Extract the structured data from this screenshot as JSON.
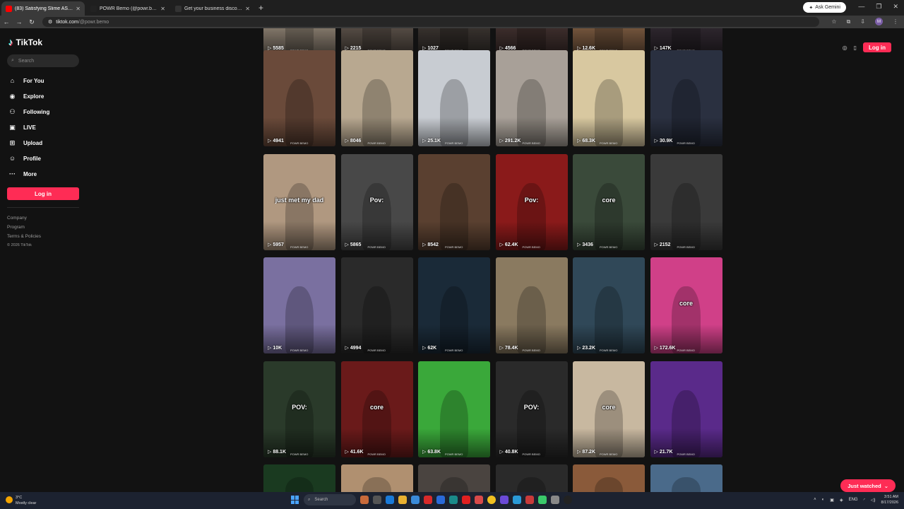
{
  "browser": {
    "tabs": [
      {
        "title": "(83) Satisfying Slime ASMR Vid",
        "favicon_color": "#ff0000",
        "active": true
      },
      {
        "title": "POWR Bemo (@powr.bemo) | T",
        "favicon_color": "#222222",
        "active": false
      },
      {
        "title": "Get your business discovered o",
        "favicon_color": "#333333",
        "active": false
      }
    ],
    "new_tab": "+",
    "gemini_label": "Ask Gemini",
    "url_host": "tiktok.com",
    "url_path": "/@powr.bemo",
    "profile_letter": "M"
  },
  "sidebar": {
    "logo_text": "TikTok",
    "search_placeholder": "Search",
    "items": [
      {
        "label": "For You",
        "icon": "home-icon"
      },
      {
        "label": "Explore",
        "icon": "compass-icon"
      },
      {
        "label": "Following",
        "icon": "following-icon"
      },
      {
        "label": "LIVE",
        "icon": "live-icon"
      },
      {
        "label": "Upload",
        "icon": "upload-icon"
      },
      {
        "label": "Profile",
        "icon": "profile-icon"
      },
      {
        "label": "More",
        "icon": "more-icon"
      }
    ],
    "login_label": "Log in",
    "footer": [
      "Company",
      "Program",
      "Terms & Policies",
      "© 2026 TikTok"
    ]
  },
  "header": {
    "login_label": "Log in"
  },
  "videos": [
    {
      "views": "5585",
      "caption": "",
      "bg": "#8a7e70"
    },
    {
      "views": "2215",
      "caption": "",
      "bg": "#5a5048"
    },
    {
      "views": "1027",
      "caption": "",
      "bg": "#3a3430"
    },
    {
      "views": "4566",
      "caption": "",
      "bg": "#40302e"
    },
    {
      "views": "12.6K",
      "caption": "",
      "bg": "#7a5a40"
    },
    {
      "views": "147K",
      "caption": "",
      "bg": "#302830"
    },
    {
      "views": "4941",
      "caption": "",
      "bg": "#6a4a3a"
    },
    {
      "views": "8046",
      "caption": "",
      "bg": "#b8a890"
    },
    {
      "views": "25.1K",
      "caption": "",
      "bg": "#c8ccd2"
    },
    {
      "views": "291.2K",
      "caption": "",
      "bg": "#a8a098"
    },
    {
      "views": "68.3K",
      "caption": "",
      "bg": "#d8c8a0"
    },
    {
      "views": "30.9K",
      "caption": "",
      "bg": "#2a3040"
    },
    {
      "views": "5957",
      "caption": "just met my dad",
      "bg": "#b09880"
    },
    {
      "views": "5865",
      "caption": "Pov:",
      "bg": "#484848"
    },
    {
      "views": "8542",
      "caption": "",
      "bg": "#5a4030"
    },
    {
      "views": "62.4K",
      "caption": "Pov:",
      "bg": "#8a1a1a"
    },
    {
      "views": "3436",
      "caption": "core",
      "bg": "#3a4a3a"
    },
    {
      "views": "2152",
      "caption": "",
      "bg": "#3a3a3a"
    },
    {
      "views": "10K",
      "caption": "",
      "bg": "#7a70a0"
    },
    {
      "views": "4994",
      "caption": "",
      "bg": "#2a2a2a"
    },
    {
      "views": "62K",
      "caption": "",
      "bg": "#1a2a38"
    },
    {
      "views": "78.4K",
      "caption": "",
      "bg": "#8a7a60"
    },
    {
      "views": "23.2K",
      "caption": "",
      "bg": "#304858"
    },
    {
      "views": "172.6K",
      "caption": "core",
      "bg": "#d04088"
    },
    {
      "views": "88.1K",
      "caption": "POV:",
      "bg": "#2a3a2a"
    },
    {
      "views": "41.6K",
      "caption": "core",
      "bg": "#6a1a1a"
    },
    {
      "views": "63.8K",
      "caption": "",
      "bg": "#3aa83a"
    },
    {
      "views": "40.8K",
      "caption": "POV:",
      "bg": "#2a2a2a"
    },
    {
      "views": "87.2K",
      "caption": "core",
      "bg": "#c8b8a0"
    },
    {
      "views": "21.7K",
      "caption": "",
      "bg": "#5a2a8a"
    },
    {
      "views": "",
      "caption": "",
      "bg": "#1a3a20"
    },
    {
      "views": "",
      "caption": "",
      "bg": "#b09070"
    },
    {
      "views": "",
      "caption": "",
      "bg": "#4a4440"
    },
    {
      "views": "",
      "caption": "",
      "bg": "#2a2a2a"
    },
    {
      "views": "",
      "caption": "",
      "bg": "#8a5a3a"
    },
    {
      "views": "",
      "caption": "",
      "bg": "#4a6a8a"
    }
  ],
  "watermark": "POWR BEMO",
  "just_watched_label": "Just watched",
  "taskbar": {
    "weather_temp": "3°C",
    "weather_desc": "Mostly clear",
    "search_placeholder": "Search",
    "lang": "ENG",
    "time": "3:51 AM",
    "date": "8/17/2026"
  }
}
